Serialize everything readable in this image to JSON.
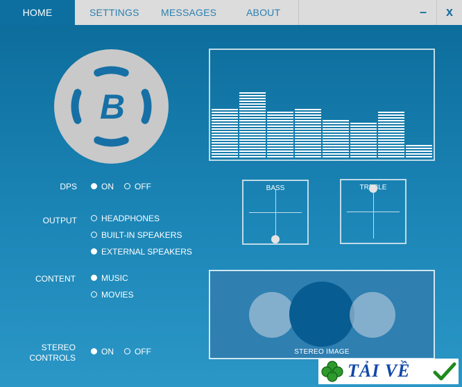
{
  "nav": {
    "tabs": [
      {
        "label": "HOME",
        "active": true
      },
      {
        "label": "SETTINGS",
        "active": false
      },
      {
        "label": "MESSAGES",
        "active": false
      },
      {
        "label": "ABOUT",
        "active": false
      }
    ],
    "minimize": "–",
    "close": "x"
  },
  "logo": {
    "icon": "brand-b-logo-icon",
    "letter": "B"
  },
  "dps": {
    "label": "DPS",
    "options": [
      {
        "label": "ON",
        "selected": true
      },
      {
        "label": "OFF",
        "selected": false
      }
    ]
  },
  "output": {
    "label": "OUTPUT",
    "options": [
      {
        "label": "HEADPHONES",
        "selected": false
      },
      {
        "label": "BUILT-IN SPEAKERS",
        "selected": false
      },
      {
        "label": "EXTERNAL SPEAKERS",
        "selected": true
      }
    ]
  },
  "content": {
    "label": "CONTENT",
    "options": [
      {
        "label": "MUSIC",
        "selected": true
      },
      {
        "label": "MOVIES",
        "selected": false
      }
    ]
  },
  "stereo_controls": {
    "label_line1": "STEREO",
    "label_line2": "CONTROLS",
    "options": [
      {
        "label": "ON",
        "selected": true
      },
      {
        "label": "OFF",
        "selected": false
      }
    ]
  },
  "equalizer": {
    "levels": [
      0.45,
      0.62,
      0.43,
      0.45,
      0.36,
      0.33,
      0.43,
      0.12
    ]
  },
  "bass": {
    "label": "BASS",
    "level": 0.0
  },
  "treble": {
    "label": "TREBLE",
    "level": 1.0
  },
  "stereo_image": {
    "label": "STEREO IMAGE"
  },
  "watermark": {
    "text": "TẢI VỀ"
  },
  "colors": {
    "accent": "#0c6fa0",
    "tab_text": "#2a7fb0",
    "topbar": "#dcdcdc",
    "logo_bg": "#c9c9c9"
  }
}
